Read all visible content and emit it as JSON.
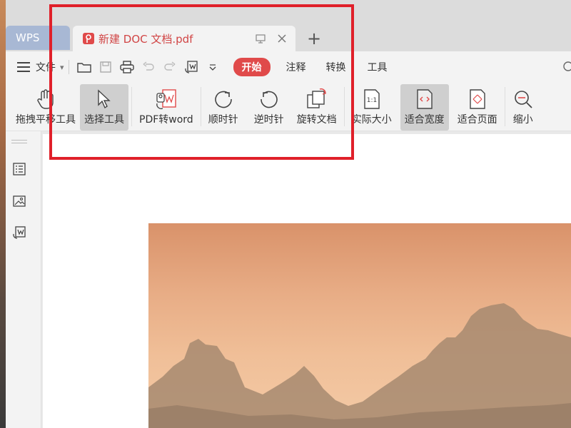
{
  "tabs": {
    "wps_label": "WPS",
    "doc_title": "新建 DOC 文档.pdf",
    "new_tab": "+"
  },
  "menu": {
    "file_label": "文件",
    "start_label": "开始",
    "items": [
      "注释",
      "转换",
      "工具"
    ]
  },
  "ribbon": {
    "buttons": [
      {
        "label": "拖拽平移工具",
        "icon": "hand-icon"
      },
      {
        "label": "选择工具",
        "icon": "cursor-icon"
      },
      {
        "label": "PDF转word",
        "icon": "pdf-to-word-icon"
      },
      {
        "label": "顺时针",
        "icon": "rotate-cw-icon"
      },
      {
        "label": "逆时针",
        "icon": "rotate-ccw-icon"
      },
      {
        "label": "旋转文档",
        "icon": "rotate-doc-icon"
      },
      {
        "label": "实际大小",
        "icon": "actual-size-icon"
      },
      {
        "label": "适合宽度",
        "icon": "fit-width-icon"
      },
      {
        "label": "适合页面",
        "icon": "fit-page-icon"
      },
      {
        "label": "缩小",
        "icon": "zoom-out-icon"
      }
    ]
  },
  "colors": {
    "accent": "#e04a4a",
    "highlight": "#e0202a",
    "tab_bar": "#dcdcdc",
    "wps_tab": "#a8b8d4"
  }
}
